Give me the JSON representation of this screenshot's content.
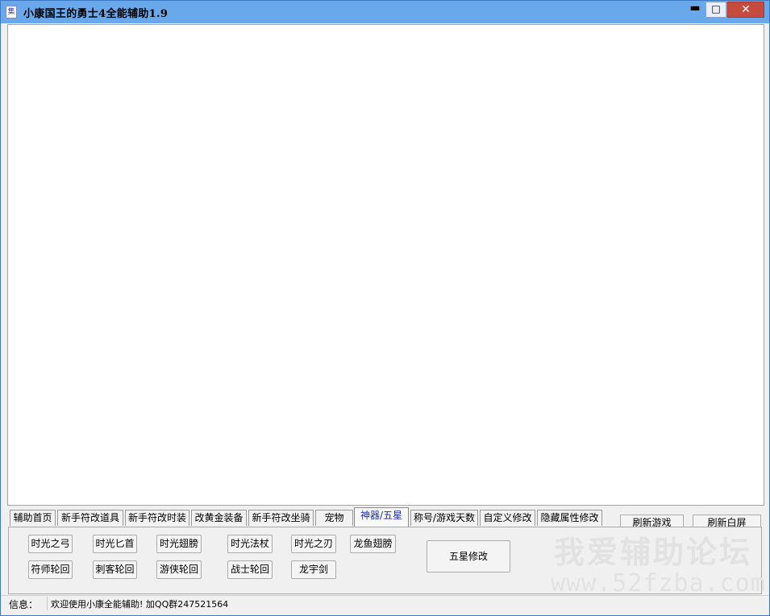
{
  "window": {
    "title": "小康国王的勇士4全能辅助1.9",
    "icon_glyph": "集"
  },
  "titlebar_controls": {
    "minimize": "▬",
    "maximize": "□",
    "close": "✕"
  },
  "tabs": [
    "辅助首页",
    "新手符改道具",
    "新手符改时装",
    "改黄金装备",
    "新手符改坐骑",
    "宠物",
    "神器/五星",
    "称号/游戏天数",
    "自定义修改",
    "隐藏属性修改"
  ],
  "active_tab": "神器/五星",
  "actions": {
    "refresh_game": "刷新游戏",
    "refresh_white": "刷新白屏"
  },
  "artifact_buttons": {
    "row1": [
      "时光之弓",
      "时光匕首",
      "时光翅膀",
      "时光法杖",
      "时光之刃",
      "龙鱼翅膀"
    ],
    "row2": [
      "符师轮回",
      "刺客轮回",
      "游侠轮回",
      "战士轮回",
      "龙宇剑"
    ]
  },
  "five_star_button": "五星修改",
  "watermark": {
    "cn": "我爱辅助论坛",
    "url": "www.52fzba.com"
  },
  "status": {
    "label": "信息：",
    "message": "欢迎使用小康全能辅助! 加QQ群247521564"
  },
  "colors": {
    "titlebar": "#6aa8ec",
    "close": "#c74a3f",
    "active_tab_text": "#1e2fa8"
  }
}
